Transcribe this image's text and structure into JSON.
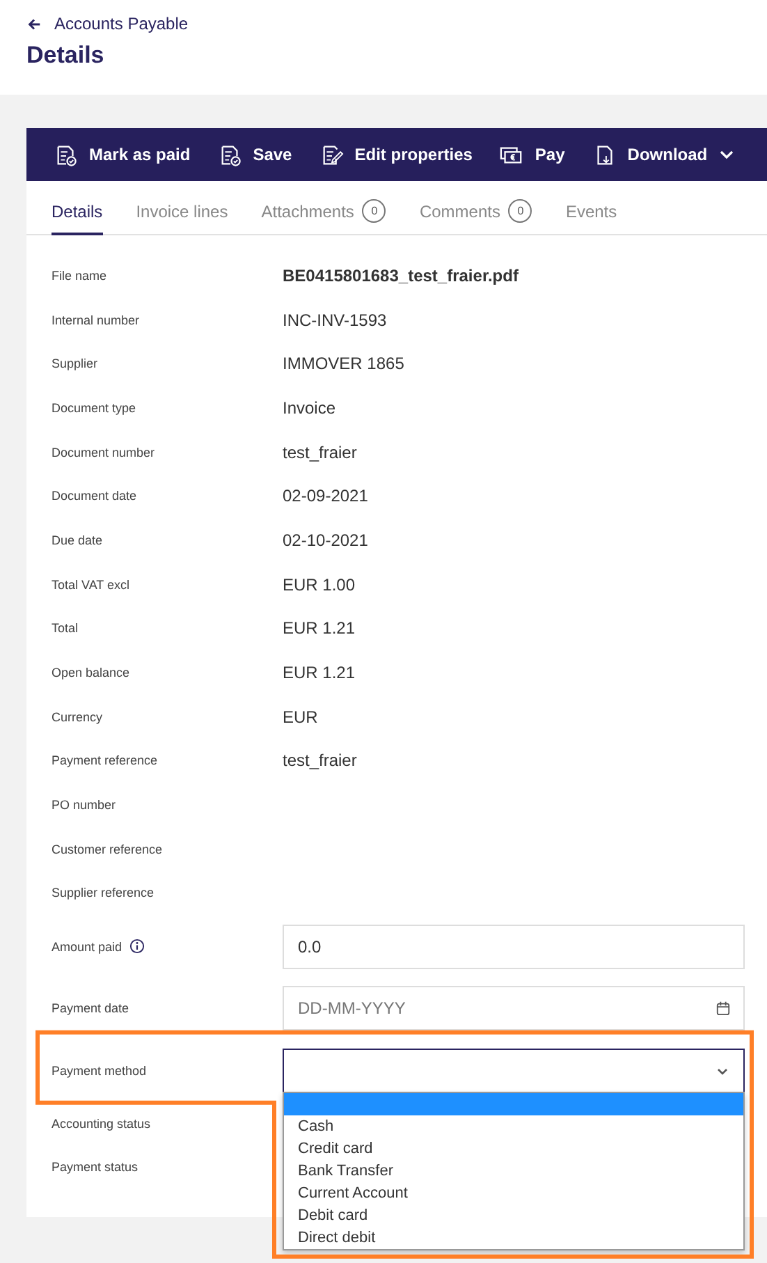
{
  "header": {
    "back_label": "Accounts Payable",
    "title": "Details"
  },
  "toolbar": [
    {
      "label": "Mark as paid"
    },
    {
      "label": "Save"
    },
    {
      "label": "Edit properties"
    },
    {
      "label": "Pay"
    },
    {
      "label": "Download",
      "menu": true
    }
  ],
  "tabs": [
    {
      "label": "Details",
      "selected": true
    },
    {
      "label": "Invoice lines",
      "selected": false
    },
    {
      "label": "Attachments",
      "selected": false,
      "count": "0"
    },
    {
      "label": "Comments",
      "selected": false,
      "count": "0"
    },
    {
      "label": "Events",
      "selected": false
    }
  ],
  "fields": [
    {
      "kind": "text",
      "label": "File name",
      "value": "BE0415801683_test_fraier.pdf",
      "bold": true
    },
    {
      "kind": "text",
      "label": "Internal number",
      "value": "INC-INV-1593",
      "bold": false
    },
    {
      "kind": "text",
      "label": "Supplier",
      "value": "IMMOVER 1865",
      "bold": false
    },
    {
      "kind": "text",
      "label": "Document type",
      "value": "Invoice",
      "bold": false
    },
    {
      "kind": "text",
      "label": "Document number",
      "value": "test_fraier",
      "bold": false
    },
    {
      "kind": "text",
      "label": "Document date",
      "value": "02-09-2021",
      "bold": false
    },
    {
      "kind": "text",
      "label": "Due date",
      "value": "02-10-2021",
      "bold": false
    },
    {
      "kind": "text",
      "label": "Total VAT excl",
      "value": "EUR 1.00",
      "bold": false
    },
    {
      "kind": "text",
      "label": "Total",
      "value": "EUR 1.21",
      "bold": false
    },
    {
      "kind": "text",
      "label": "Open balance",
      "value": "EUR 1.21",
      "bold": false
    },
    {
      "kind": "text",
      "label": "Currency",
      "value": "EUR",
      "bold": false
    },
    {
      "kind": "text",
      "label": "Payment reference",
      "value": "test_fraier",
      "bold": false
    },
    {
      "kind": "text",
      "label": "PO number"
    },
    {
      "kind": "text",
      "label": "Customer reference"
    },
    {
      "kind": "text",
      "label": "Supplier reference"
    },
    {
      "kind": "input",
      "label": "Amount paid",
      "value": "0.0",
      "info": true
    },
    {
      "kind": "date",
      "label": "Payment date",
      "placeholder": "DD-MM-YYYY"
    },
    {
      "kind": "select",
      "label": "Payment method",
      "expanded": true,
      "highlighted": true,
      "blank_option_selected": true,
      "options": [
        {
          "label": "Cash",
          "selected": false
        },
        {
          "label": "Credit card",
          "selected": false
        },
        {
          "label": "Bank Transfer",
          "selected": false
        },
        {
          "label": "Current Account",
          "selected": false
        },
        {
          "label": "Debit card",
          "selected": false
        },
        {
          "label": "Direct debit",
          "selected": false
        }
      ]
    },
    {
      "kind": "text",
      "label": "Accounting status"
    },
    {
      "kind": "text",
      "label": "Payment status"
    }
  ]
}
